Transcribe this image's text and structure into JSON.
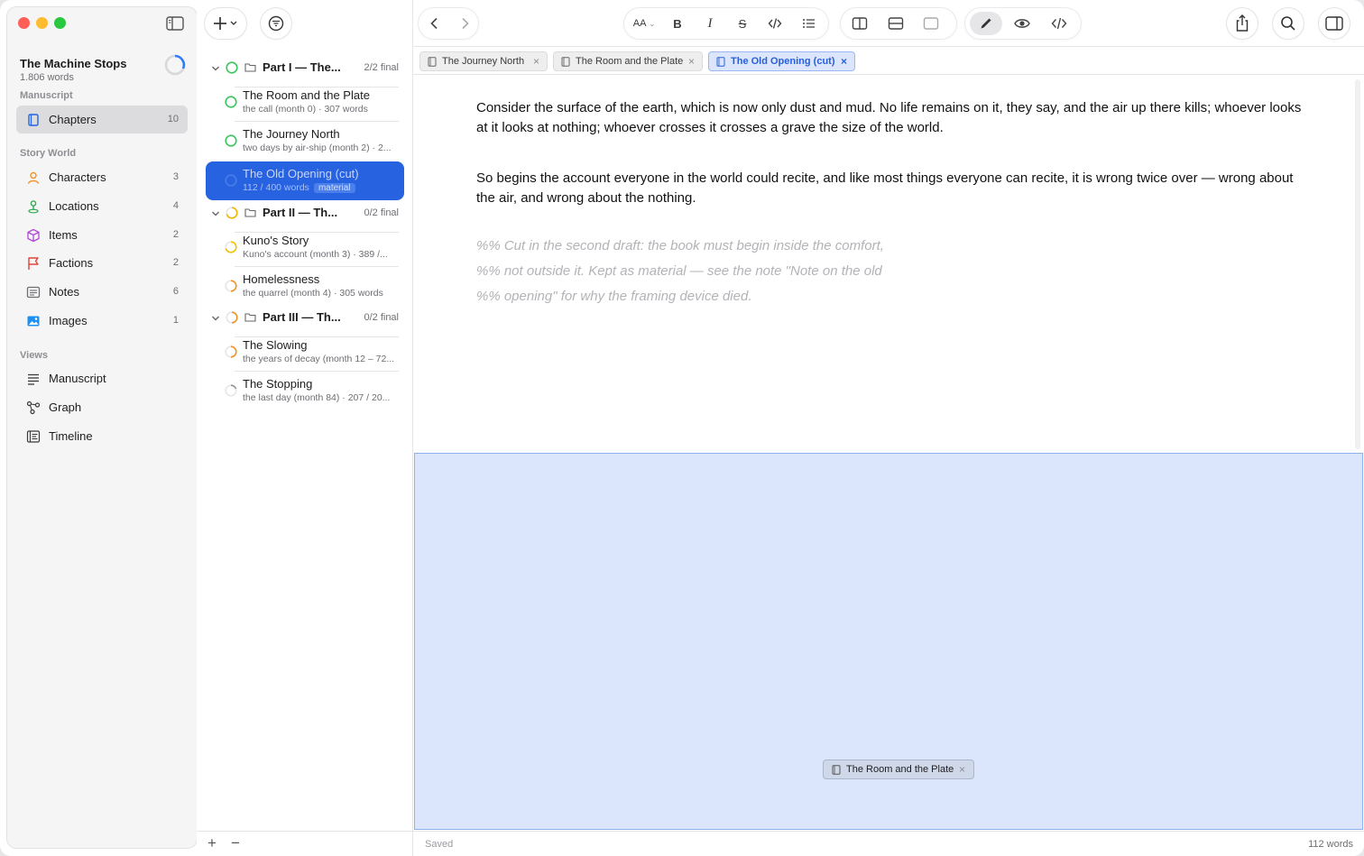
{
  "project": {
    "title": "The Machine Stops",
    "words": "1.806 words"
  },
  "sidebar": {
    "manuscript_head": "Manuscript",
    "chapters": {
      "label": "Chapters",
      "count": "10"
    },
    "story_head": "Story World",
    "world": [
      {
        "label": "Characters",
        "count": "3"
      },
      {
        "label": "Locations",
        "count": "4"
      },
      {
        "label": "Items",
        "count": "2"
      },
      {
        "label": "Factions",
        "count": "2"
      },
      {
        "label": "Notes",
        "count": "6"
      },
      {
        "label": "Images",
        "count": "1"
      }
    ],
    "views_head": "Views",
    "views": [
      {
        "label": "Manuscript"
      },
      {
        "label": "Graph"
      },
      {
        "label": "Timeline"
      }
    ]
  },
  "list": {
    "parts": [
      {
        "title": "Part I — The...",
        "count": "2/2 final"
      },
      {
        "title": "Part II — Th...",
        "count": "0/2 final"
      },
      {
        "title": "Part III — Th...",
        "count": "0/2 final"
      }
    ],
    "chapters": [
      {
        "title": "The Room and the Plate",
        "sub": "the call (month 0) · 307 words"
      },
      {
        "title": "The Journey North",
        "sub": "two days by air-ship (month 2) · 2..."
      },
      {
        "title": "The Old Opening (cut)",
        "sub": "112 / 400 words",
        "badge": "material"
      },
      {
        "title": "Kuno's Story",
        "sub": "Kuno's account (month 3) · 389 /..."
      },
      {
        "title": "Homelessness",
        "sub": "the quarrel (month 4) · 305 words"
      },
      {
        "title": "The Slowing",
        "sub": "the years of decay (month 12 – 72..."
      },
      {
        "title": "The Stopping",
        "sub": "the last day (month 84) · 207 / 20..."
      }
    ],
    "add": "+",
    "remove": "−"
  },
  "toolbar": {
    "text_size": "AA",
    "bold": "B",
    "italic": "I",
    "strike": "S"
  },
  "tabs": [
    {
      "label": "The Journey North"
    },
    {
      "label": "The Room and the Plate"
    },
    {
      "label": "The Old Opening (cut)"
    }
  ],
  "editor": {
    "p1": "Consider the surface of the earth, which is now only dust and mud. No life remains on it, they say, and the air up there kills; whoever looks at it looks at nothing; whoever crosses it crosses a grave the size of the world.",
    "p2": "So begins the account everyone in the world could recite, and like most things everyone can recite, it is wrong twice over — wrong about the air, and wrong about the nothing.",
    "c1": "%% Cut in the second draft: the book must begin inside the comfort,",
    "c2": "%% not outside it. Kept as material — see the note \"Note on the old",
    "c3": "%% opening\" for why the framing device died."
  },
  "drag_tab": {
    "label": "The Room and the Plate"
  },
  "status": {
    "saved": "Saved",
    "words": "112 words"
  },
  "colors": {
    "accent": "#2762e0",
    "final": "#34c759",
    "draft": "#f5a623",
    "close": "#ff5f57",
    "minimize": "#febc2e",
    "zoom": "#28c840"
  }
}
